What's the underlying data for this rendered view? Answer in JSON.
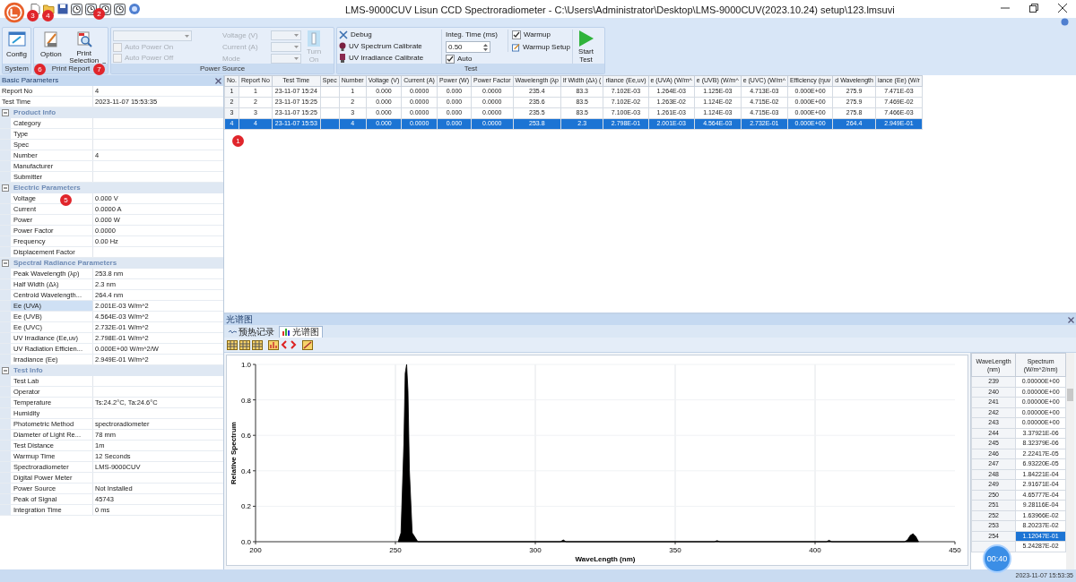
{
  "window": {
    "title": "LMS-9000CUV Lisun CCD Spectroradiometer - C:\\Users\\Administrator\\Desktop\\LMS-9000CUV(2023.10.24) setup\\123.lmsuvi"
  },
  "ribbon": {
    "system": {
      "title": "System",
      "config": "Config"
    },
    "print_report": {
      "title": "Print Report",
      "option": "Option",
      "print_selection": "Print Selection"
    },
    "power_source": {
      "title": "Power Source",
      "combo": {
        "disabled": true
      },
      "auto_power_on": {
        "label": "Auto Power On",
        "checked": false,
        "disabled": true
      },
      "auto_power_off": {
        "label": "Auto Power Off",
        "checked": false,
        "disabled": true
      },
      "fields": [
        {
          "label": "Voltage (V)",
          "disabled": true
        },
        {
          "label": "Current (A)",
          "disabled": true
        },
        {
          "label": "Mode",
          "disabled": true
        }
      ],
      "turn_on": {
        "label": "Turn On",
        "disabled": true
      }
    },
    "test": {
      "title": "Test",
      "debug": "Debug",
      "uv_spectrum_calibrate": "UV Spectrum Calibrate",
      "uv_irradiance_calibrate": "UV Irradiance Calibrate",
      "integ_time": {
        "label": "Integ. Time (ms)",
        "value": "0.50"
      },
      "auto": {
        "label": "Auto",
        "checked": true
      },
      "warmup": {
        "label": "Warmup",
        "checked": true
      },
      "warmup_setup": "Warmup Setup",
      "start_test": "Start Test"
    }
  },
  "markers": [
    "3",
    "4",
    "2",
    "6",
    "7",
    "1",
    "5"
  ],
  "basic_parameters": {
    "title": "Basic Parameters",
    "rows": [
      {
        "label": "Report No",
        "value": "4",
        "selected": false
      },
      {
        "label": "Test Time",
        "value": "2023-11-07 15:53:35",
        "selected": false
      }
    ],
    "sections": [
      {
        "title": "Product Info",
        "expanded": true,
        "rows": [
          {
            "label": "Category",
            "selected": false
          },
          {
            "label": "Type",
            "selected": false
          },
          {
            "label": "Spec",
            "selected": false
          },
          {
            "label": "Number",
            "value": "4",
            "selected": false
          },
          {
            "label": "Manufacturer",
            "selected": false
          },
          {
            "label": "Submitter",
            "selected": false
          }
        ]
      },
      {
        "title": "Electric Parameters",
        "expanded": true,
        "rows": [
          {
            "label": "Voltage",
            "value": "0.000 V",
            "selected": false
          },
          {
            "label": "Current",
            "value": "0.0000 A",
            "selected": false
          },
          {
            "label": "Power",
            "value": "0.000 W",
            "selected": false
          },
          {
            "label": "Power Factor",
            "value": "0.0000",
            "selected": false
          },
          {
            "label": "Frequency",
            "value": "0.00 Hz",
            "selected": false
          },
          {
            "label": "Displacement Factor",
            "selected": false
          }
        ]
      },
      {
        "title": "Spectral Radiance Parameters",
        "expanded": true,
        "rows": [
          {
            "label": "Peak Wavelength (λp)",
            "value": "253.8 nm",
            "selected": false
          },
          {
            "label": "Half Width (Δλ)",
            "value": "2.3 nm",
            "selected": false
          },
          {
            "label": "Centroid Wavelength...",
            "value": "264.4 nm",
            "selected": false
          },
          {
            "label": "Ee (UVA)",
            "value": "2.001E-03 W/m^2",
            "selected": true
          },
          {
            "label": "Ee (UVB)",
            "value": "4.564E-03 W/m^2",
            "selected": false
          },
          {
            "label": "Ee (UVC)",
            "value": "2.732E-01 W/m^2",
            "selected": false
          },
          {
            "label": "UV Irradiance (Ee,uv)",
            "value": "2.798E-01 W/m^2",
            "selected": false
          },
          {
            "label": "UV Radiation Efficien...",
            "value": "0.000E+00 W/m^2/W",
            "selected": false
          },
          {
            "label": "Irradiance (Ee)",
            "value": "2.949E-01 W/m^2",
            "selected": false
          }
        ]
      },
      {
        "title": "Test Info",
        "expanded": true,
        "rows": [
          {
            "label": "Test Lab",
            "selected": false
          },
          {
            "label": "Operator",
            "selected": false
          },
          {
            "label": "Temperature",
            "value": "Ts:24.2°C, Ta:24.6°C",
            "selected": false
          },
          {
            "label": "Humidity",
            "selected": false
          },
          {
            "label": "Photometric Method",
            "value": "spectroradiometer",
            "selected": false
          },
          {
            "label": "Diameter of Light Re...",
            "value": "78 mm",
            "selected": false
          },
          {
            "label": "Test Distance",
            "value": "1m",
            "selected": false
          },
          {
            "label": "Warmup Time",
            "value": "12 Seconds",
            "selected": false
          },
          {
            "label": "Spectroradiometer",
            "value": "LMS-9000CUV",
            "selected": false
          },
          {
            "label": "Digital Power Meter",
            "selected": false
          },
          {
            "label": "Power Source",
            "value": "Not Installed",
            "selected": false
          },
          {
            "label": "Peak of Signal",
            "value": "45743",
            "selected": false
          },
          {
            "label": "Integration Time",
            "value": "0 ms",
            "selected": false
          }
        ]
      }
    ]
  },
  "results_table": {
    "columns": [
      "No.",
      "Report No",
      "Test Time",
      "Spec",
      "Number",
      "Voltage (V)",
      "Current (A)",
      "Power (W)",
      "Power Factor",
      "Wavelength (λp",
      "lf Width (Δλ) (",
      "rliance (Ee,uv)",
      "e (UVA) (W/m^",
      "e (UVB) (W/m^",
      "e (UVC) (W/m^",
      "Efficiency (ηuv",
      "d Wavelength",
      "iance (Ee) (W/r"
    ],
    "rows": [
      {
        "selected": false,
        "cells": [
          "1",
          "1",
          "23-11-07 15:24",
          "",
          "1",
          "0.000",
          "0.0000",
          "0.000",
          "0.0000",
          "235.4",
          "83.3",
          "7.102E-03",
          "1.264E-03",
          "1.125E-03",
          "4.713E-03",
          "0.000E+00",
          "275.9",
          "7.471E-03"
        ]
      },
      {
        "selected": false,
        "cells": [
          "2",
          "2",
          "23-11-07 15:25",
          "",
          "2",
          "0.000",
          "0.0000",
          "0.000",
          "0.0000",
          "235.6",
          "83.5",
          "7.102E-02",
          "1.263E-02",
          "1.124E-02",
          "4.715E-02",
          "0.000E+00",
          "275.9",
          "7.469E-02"
        ]
      },
      {
        "selected": false,
        "cells": [
          "3",
          "3",
          "23-11-07 15:25",
          "",
          "3",
          "0.000",
          "0.0000",
          "0.000",
          "0.0000",
          "235.5",
          "83.5",
          "7.100E-03",
          "1.261E-03",
          "1.124E-03",
          "4.715E-03",
          "0.000E+00",
          "275.8",
          "7.466E-03"
        ]
      },
      {
        "selected": true,
        "cells": [
          "4",
          "4",
          "23-11-07 15:53",
          "",
          "4",
          "0.000",
          "0.0000",
          "0.000",
          "0.0000",
          "253.8",
          "2.3",
          "2.798E-01",
          "2.001E-03",
          "4.564E-03",
          "2.732E-01",
          "0.000E+00",
          "264.4",
          "2.949E-01"
        ]
      }
    ]
  },
  "spectrum_panel": {
    "title": "光谱图",
    "tabs": [
      {
        "label": "预热记录",
        "selected": false
      },
      {
        "label": "光谱图",
        "selected": true
      }
    ],
    "chart_data": {
      "type": "area",
      "xlabel": "WaveLength (nm)",
      "ylabel": "Relative Spectrum",
      "xlim": [
        200,
        450
      ],
      "ylim": [
        0,
        1
      ],
      "xticks": [
        200,
        250,
        300,
        350,
        400,
        450
      ],
      "yticks": [
        {
          "value": 0,
          "label": "0.0"
        },
        {
          "value": 0.2,
          "label": "0.2"
        },
        {
          "value": 0.4,
          "label": "0.4"
        },
        {
          "value": 0.6,
          "label": "0.6"
        },
        {
          "value": 0.8,
          "label": "0.8"
        },
        {
          "value": 1,
          "label": "1.0"
        }
      ],
      "grid": true,
      "x": [
        251,
        252,
        253,
        253.5,
        254,
        254.5,
        255,
        256,
        258,
        300,
        309,
        310,
        311,
        364,
        365,
        366,
        404,
        405,
        406,
        432,
        433,
        434,
        435,
        436,
        437
      ],
      "series": [
        {
          "color": "#000000",
          "values": [
            0,
            0.05,
            0.55,
            0.95,
            1,
            0.85,
            0.4,
            0.05,
            0,
            0,
            0,
            0.01,
            0,
            0,
            0.006,
            0,
            0,
            0.008,
            0,
            0,
            0.01,
            0.035,
            0.045,
            0.03,
            0
          ]
        }
      ]
    },
    "table": {
      "columns": [
        "WaveLength (nm)",
        "Spectrum (W/m^2/nm)"
      ],
      "rows": [
        {
          "wavelength": "239",
          "spectrum": "0.00000E+00",
          "selected": false
        },
        {
          "wavelength": "240",
          "spectrum": "0.00000E+00",
          "selected": false
        },
        {
          "wavelength": "241",
          "spectrum": "0.00000E+00",
          "selected": false
        },
        {
          "wavelength": "242",
          "spectrum": "0.00000E+00",
          "selected": false
        },
        {
          "wavelength": "243",
          "spectrum": "0.00000E+00",
          "selected": false
        },
        {
          "wavelength": "244",
          "spectrum": "3.37921E-06",
          "selected": false
        },
        {
          "wavelength": "245",
          "spectrum": "8.32379E-06",
          "selected": false
        },
        {
          "wavelength": "246",
          "spectrum": "2.22417E-05",
          "selected": false
        },
        {
          "wavelength": "247",
          "spectrum": "6.93220E-05",
          "selected": false
        },
        {
          "wavelength": "248",
          "spectrum": "1.84221E-04",
          "selected": false
        },
        {
          "wavelength": "249",
          "spectrum": "2.91671E-04",
          "selected": false
        },
        {
          "wavelength": "250",
          "spectrum": "4.65777E-04",
          "selected": false
        },
        {
          "wavelength": "251",
          "spectrum": "9.28116E-04",
          "selected": false
        },
        {
          "wavelength": "252",
          "spectrum": "1.63966E-02",
          "selected": false
        },
        {
          "wavelength": "253",
          "spectrum": "8.20237E-02",
          "selected": false
        },
        {
          "wavelength": "254",
          "spectrum": "1.12047E-01",
          "selected": true
        },
        {
          "spectrum": "5.24287E-02",
          "selected": false
        }
      ]
    }
  },
  "timer_badge": "00:40",
  "status_bar": {
    "datetime": "2023-11-07 15:53:35"
  }
}
